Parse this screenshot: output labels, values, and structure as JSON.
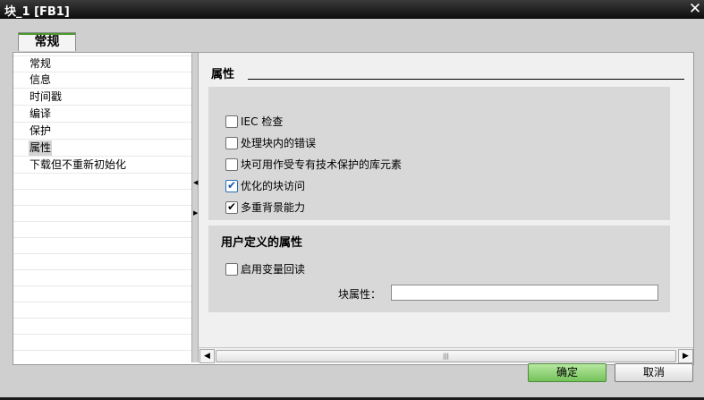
{
  "window": {
    "title": "块_1 [FB1]",
    "close": "✕"
  },
  "tabs": [
    {
      "label": "常规"
    }
  ],
  "nav": {
    "items": [
      "常规",
      "信息",
      "时间戳",
      "编译",
      "保护",
      "属性",
      "下载但不重新初始化"
    ],
    "selected_index": 5
  },
  "splitter": {
    "collapse": "◀",
    "expand": "▶"
  },
  "content": {
    "section_title": "属性",
    "checkboxes": [
      {
        "label": "IEC 检查",
        "checked": false
      },
      {
        "label": "处理块内的错误",
        "checked": false
      },
      {
        "label": "块可用作受专有技术保护的库元素",
        "checked": false
      },
      {
        "label": "优化的块访问",
        "checked": true
      },
      {
        "label": "多重背景能力",
        "checked": true
      }
    ],
    "user_section_title": "用户定义的属性",
    "user_checkbox": {
      "label": "启用变量回读",
      "checked": false
    },
    "block_property_label": "块属性：",
    "block_property_value": ""
  },
  "scrollbar": {
    "left": "◀",
    "right": "▶",
    "grip": "|||"
  },
  "buttons": {
    "ok": "确定",
    "cancel": "取消"
  },
  "colors": {
    "accent": "#4a9a2c",
    "ok_button": "#74c25a",
    "check_blue": "#1a56b0"
  }
}
